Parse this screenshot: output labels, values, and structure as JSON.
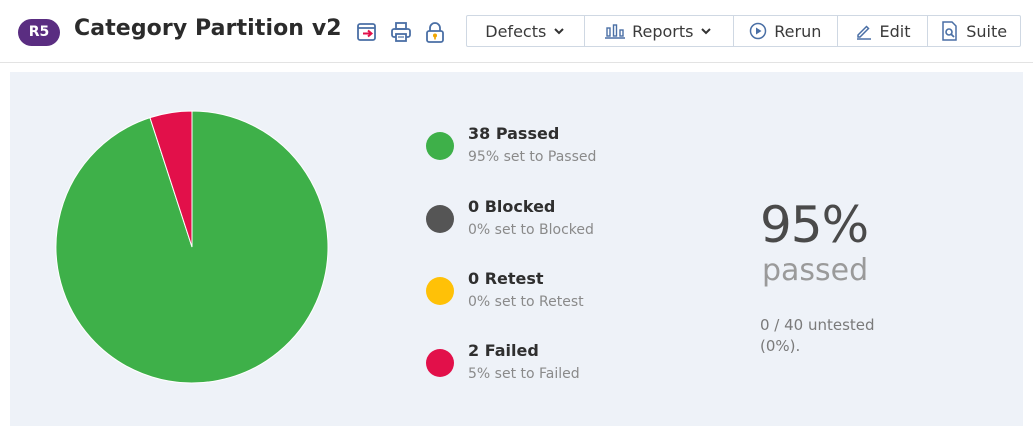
{
  "header": {
    "run_badge": "R5",
    "title": "Category Partition v2",
    "icons": [
      "export-icon",
      "print-icon",
      "lock-icon"
    ],
    "toolbar": [
      {
        "label": "Defects",
        "icon": "chevron-down-icon"
      },
      {
        "label": "Reports",
        "icon": "bar-chart-icon"
      },
      {
        "label": "Rerun",
        "icon": "play-circle-icon"
      },
      {
        "label": "Edit",
        "icon": "pencil-icon"
      },
      {
        "label": "Suite",
        "icon": "document-search-icon"
      }
    ]
  },
  "summary": {
    "chart_data": {
      "type": "pie",
      "categories": [
        "Passed",
        "Blocked",
        "Retest",
        "Failed"
      ],
      "values": [
        38,
        0,
        0,
        2
      ],
      "colors": [
        "#3eb049",
        "#555555",
        "#ffc107",
        "#e2104a"
      ]
    },
    "legend": [
      {
        "count_label": "38 Passed",
        "sub_label": "95% set to Passed",
        "color": "#3eb049"
      },
      {
        "count_label": "0 Blocked",
        "sub_label": "0% set to Blocked",
        "color": "#555555"
      },
      {
        "count_label": "0 Retest",
        "sub_label": "0% set to Retest",
        "color": "#ffc107"
      },
      {
        "count_label": "2 Failed",
        "sub_label": "5% set to Failed",
        "color": "#e2104a"
      }
    ],
    "percent": "95%",
    "percent_label": "passed",
    "untested_line1": "0 / 40 untested",
    "untested_line2": "(0%)."
  }
}
